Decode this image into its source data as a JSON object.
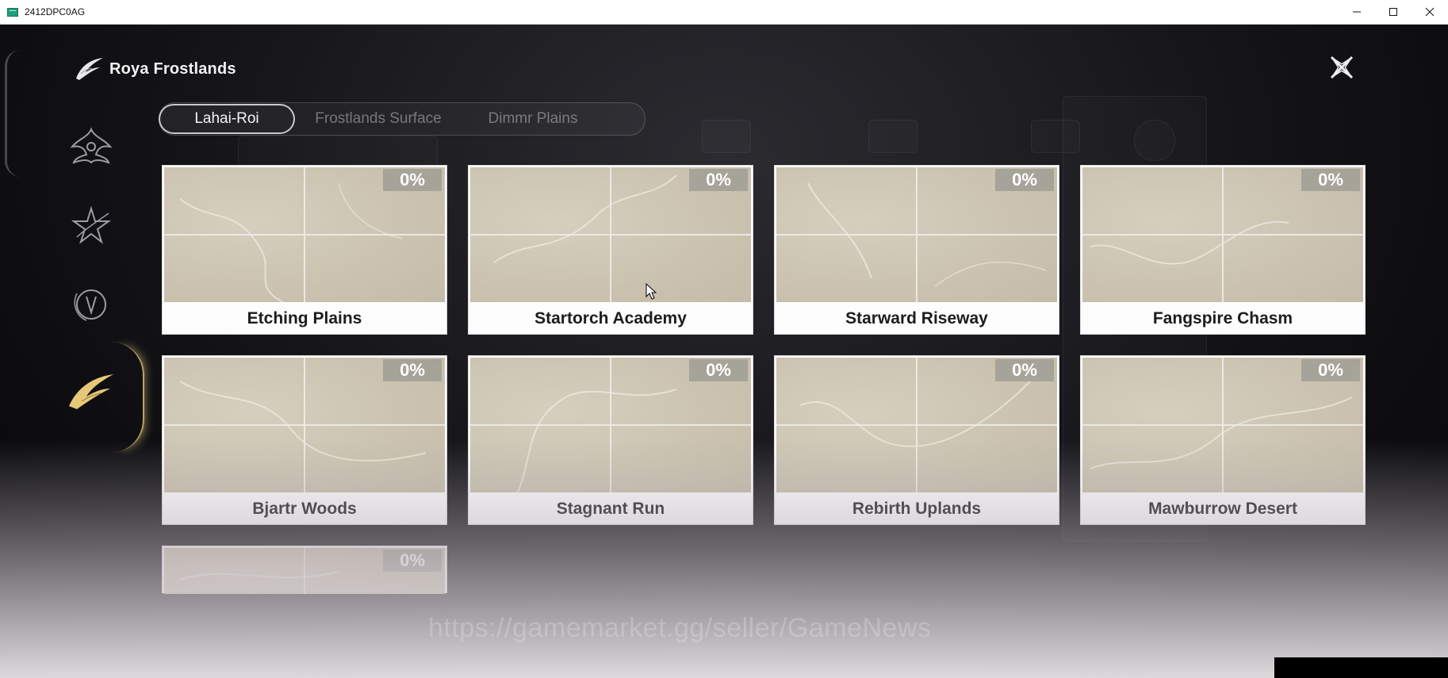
{
  "window": {
    "title": "2412DPC0AG",
    "controls": [
      "minimize-icon",
      "maximize-icon",
      "close-icon"
    ]
  },
  "header": {
    "region_title": "Roya Frostlands",
    "logo_icon": "frostlands-emblem-icon",
    "close_icon": "star-close-icon"
  },
  "side_nav": {
    "items": [
      {
        "icon": "dragon-emblem-icon",
        "active": false
      },
      {
        "icon": "star-emblem-icon",
        "active": false
      },
      {
        "icon": "circle-emblem-icon",
        "active": false
      },
      {
        "icon": "frostlands-emblem-icon",
        "active": true
      }
    ]
  },
  "tabs": [
    {
      "label": "Lahai-Roi",
      "active": true
    },
    {
      "label": "Frostlands Surface",
      "active": false
    },
    {
      "label": "Dimmr Plains",
      "active": false
    }
  ],
  "areas": [
    {
      "name": "Etching Plains",
      "progress": "0%"
    },
    {
      "name": "Startorch Academy",
      "progress": "0%"
    },
    {
      "name": "Starward Riseway",
      "progress": "0%"
    },
    {
      "name": "Fangspire Chasm",
      "progress": "0%"
    },
    {
      "name": "Bjartr Woods",
      "progress": "0%"
    },
    {
      "name": "Stagnant Run",
      "progress": "0%"
    },
    {
      "name": "Rebirth Uplands",
      "progress": "0%"
    },
    {
      "name": "Mawburrow Desert",
      "progress": "0%"
    },
    {
      "name": "",
      "progress": "0%"
    }
  ],
  "watermark": "https://gamemarket.gg/seller/GameNews",
  "colors": {
    "card_bg": "#fdfdfd",
    "map_beige": "#cbc3b0",
    "badge": "#a09e96",
    "accent_gold": "#e6c878"
  }
}
